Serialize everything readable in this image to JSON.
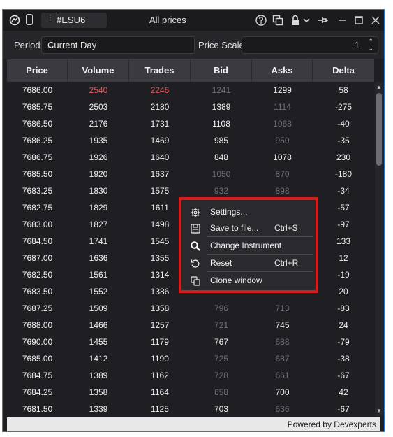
{
  "window": {
    "symbol": "#ESU6",
    "title": "All prices"
  },
  "toolbar": {
    "period_label": "Period:",
    "period_value": "Current Day",
    "price_scale_label": "Price Scale:",
    "price_scale_value": "1"
  },
  "table": {
    "columns": [
      "Price",
      "Volume",
      "Trades",
      "Bid",
      "Asks",
      "Delta"
    ],
    "rows": [
      [
        "7686.00",
        "2540",
        "2246",
        "1241",
        "1299",
        "58"
      ],
      [
        "7685.75",
        "2503",
        "2180",
        "1389",
        "1114",
        "-275"
      ],
      [
        "7686.50",
        "2176",
        "1731",
        "1108",
        "1068",
        "-40"
      ],
      [
        "7686.25",
        "1935",
        "1469",
        "985",
        "950",
        "-35"
      ],
      [
        "7686.75",
        "1926",
        "1640",
        "848",
        "1078",
        "230"
      ],
      [
        "7685.50",
        "1920",
        "1637",
        "1050",
        "870",
        "-180"
      ],
      [
        "7683.25",
        "1830",
        "1575",
        "932",
        "898",
        "-34"
      ],
      [
        "7682.75",
        "1829",
        "1611",
        "",
        "",
        "-57"
      ],
      [
        "7683.00",
        "1827",
        "1498",
        "",
        "",
        "-97"
      ],
      [
        "7684.50",
        "1741",
        "1545",
        "",
        "",
        "133"
      ],
      [
        "7687.00",
        "1636",
        "1355",
        "",
        "",
        "12"
      ],
      [
        "7682.50",
        "1561",
        "1314",
        "",
        "",
        "-19"
      ],
      [
        "7683.50",
        "1552",
        "1386",
        "",
        "",
        "20"
      ],
      [
        "7687.25",
        "1509",
        "1358",
        "796",
        "713",
        "-83"
      ],
      [
        "7688.00",
        "1466",
        "1257",
        "721",
        "745",
        "24"
      ],
      [
        "7690.00",
        "1455",
        "1179",
        "767",
        "688",
        "-79"
      ],
      [
        "7685.00",
        "1412",
        "1190",
        "725",
        "687",
        "-38"
      ],
      [
        "7684.75",
        "1389",
        "1162",
        "728",
        "661",
        "-67"
      ],
      [
        "7684.25",
        "1358",
        "1164",
        "658",
        "700",
        "42"
      ],
      [
        "7681.50",
        "1339",
        "1125",
        "703",
        "636",
        "-67"
      ]
    ]
  },
  "context_menu": {
    "items": [
      {
        "label": "Settings...",
        "shortcut": "",
        "icon": "gear-icon"
      },
      {
        "label": "Save to file...",
        "shortcut": "Ctrl+S",
        "icon": "save-icon"
      },
      {
        "label": "Change Instrument",
        "shortcut": "",
        "icon": "search-icon"
      },
      {
        "label": "Reset",
        "shortcut": "Ctrl+R",
        "icon": "reset-icon"
      },
      {
        "label": "Clone window",
        "shortcut": "",
        "icon": "clone-icon"
      }
    ]
  },
  "footer": {
    "text": "Powered by Devexperts"
  },
  "colors": {
    "window_border": "#1e7bd8",
    "highlight_border": "#d81b1b",
    "highlight_text": "#e05a5a",
    "dim_text": "#6f6f78"
  }
}
